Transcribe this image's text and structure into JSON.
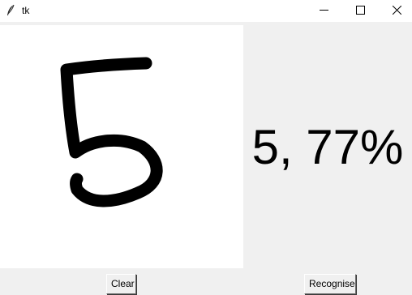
{
  "window": {
    "title": "tk",
    "controls": {
      "minimize_icon": "minimize-icon",
      "maximize_icon": "maximize-icon",
      "close_icon": "close-icon"
    }
  },
  "canvas": {
    "background": "#ffffff",
    "stroke_color": "#000000"
  },
  "result": {
    "text": "5, 77%"
  },
  "buttons": {
    "clear_label": "Clear",
    "recognise_label": "Recognise"
  }
}
